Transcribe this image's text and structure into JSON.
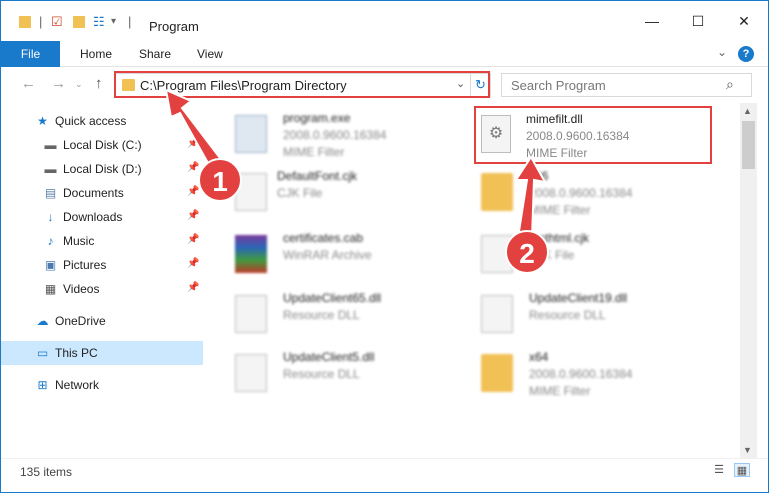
{
  "window": {
    "title": "Program",
    "minimize": "—",
    "maximize": "☐",
    "close": "✕"
  },
  "ribbon": {
    "file": "File",
    "home": "Home",
    "share": "Share",
    "view": "View",
    "help": "?"
  },
  "address": {
    "path": "C:\\Program Files\\Program Directory"
  },
  "search": {
    "placeholder": "Search Program"
  },
  "sidebar": {
    "quick_access": "Quick access",
    "items": [
      {
        "label": "Local Disk (C:)",
        "icon": "drive-icon"
      },
      {
        "label": "Local Disk (D:)",
        "icon": "drive-icon"
      },
      {
        "label": "Documents",
        "icon": "documents-icon"
      },
      {
        "label": "Downloads",
        "icon": "downloads-icon"
      },
      {
        "label": "Music",
        "icon": "music-icon"
      },
      {
        "label": "Pictures",
        "icon": "pictures-icon"
      },
      {
        "label": "Videos",
        "icon": "videos-icon"
      }
    ],
    "onedrive": "OneDrive",
    "this_pc": "This PC",
    "network": "Network"
  },
  "files": [
    {
      "name": "program.exe",
      "line2": "2008.0.9600.16384",
      "line3": "MIME Filter",
      "icon": "exe-icon"
    },
    {
      "name": "mimefilt.dll",
      "line2": "2008.0.9600.16384",
      "line3": "MIME Filter",
      "icon": "dll-gear-icon"
    },
    {
      "name": "DefaultFont.cjk",
      "line2": "CJK File",
      "line3": "",
      "icon": "file-icon"
    },
    {
      "name": "x86",
      "line2": "2008.0.9600.16384",
      "line3": "MIME Filter",
      "icon": "folder-icon"
    },
    {
      "name": "certificates.cab",
      "line2": "WinRAR Archive",
      "line3": "",
      "icon": "winrar-icon"
    },
    {
      "name": "testhtml.cjk",
      "line2": "CJK File",
      "line3": "",
      "icon": "file-icon"
    },
    {
      "name": "UpdateClient65.dll",
      "line2": "Resource DLL",
      "line3": "",
      "icon": "dll-gear-icon"
    },
    {
      "name": "UpdateClient19.dll",
      "line2": "Resource DLL",
      "line3": "",
      "icon": "dll-gear-icon"
    },
    {
      "name": "UpdateClient5.dll",
      "line2": "Resource DLL",
      "line3": "",
      "icon": "dll-gear-icon"
    },
    {
      "name": "x64",
      "line2": "2008.0.9600.16384",
      "line3": "MIME Filter",
      "icon": "folder-icon"
    }
  ],
  "status": {
    "count": "135 items"
  },
  "annotations": {
    "step1": "1",
    "step2": "2",
    "color": "#e34040"
  }
}
